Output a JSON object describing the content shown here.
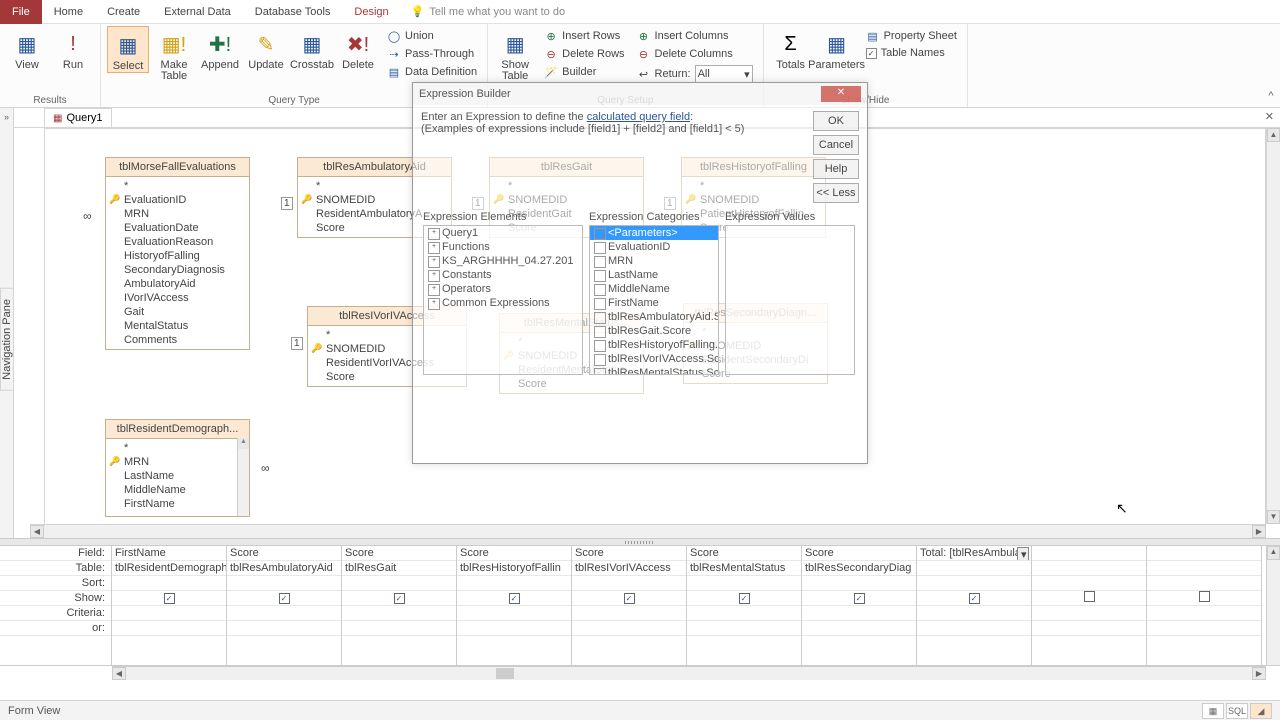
{
  "tabs": {
    "file": "File",
    "home": "Home",
    "create": "Create",
    "external": "External Data",
    "dbtools": "Database Tools",
    "design": "Design",
    "tellme": "Tell me what you want to do"
  },
  "ribbon": {
    "results": {
      "view": "View",
      "run": "Run",
      "label": "Results"
    },
    "qtype": {
      "select": "Select",
      "make": "Make\nTable",
      "append": "Append",
      "update": "Update",
      "crosstab": "Crosstab",
      "delete": "Delete",
      "union": "Union",
      "pass": "Pass-Through",
      "datadef": "Data Definition",
      "label": "Query Type"
    },
    "setup": {
      "show": "Show\nTable",
      "insrow": "Insert Rows",
      "delrow": "Delete Rows",
      "builder": "Builder",
      "inscol": "Insert Columns",
      "delcol": "Delete Columns",
      "return": "Return:",
      "retval": "All",
      "label": "Query Setup"
    },
    "showhide": {
      "totals": "Totals",
      "params": "Parameters",
      "prop": "Property Sheet",
      "tnames": "Table Names",
      "label": "Show/Hide"
    }
  },
  "qtab": "Query1",
  "tables": {
    "t1": {
      "name": "tblMorseFallEvaluations",
      "fields": [
        "*",
        "EvaluationID",
        "MRN",
        "EvaluationDate",
        "EvaluationReason",
        "HistoryofFalling",
        "SecondaryDiagnosis",
        "AmbulatoryAid",
        "IVorIVAccess",
        "Gait",
        "MentalStatus",
        "Comments"
      ],
      "keyIdx": 1
    },
    "t2": {
      "name": "tblResidentDemograph...",
      "fields": [
        "*",
        "MRN",
        "LastName",
        "MiddleName",
        "FirstName"
      ],
      "keyIdx": 1
    },
    "t3": {
      "name": "tblResAmbulatoryAid",
      "fields": [
        "*",
        "SNOMEDID",
        "ResidentAmbulatoryA",
        "Score"
      ],
      "keyIdx": 1
    },
    "t4": {
      "name": "tblResIVorIVAccess",
      "fields": [
        "*",
        "SNOMEDID",
        "ResidentIVorIVAccess",
        "Score"
      ],
      "keyIdx": 1
    },
    "t5": {
      "name": "tblResGait",
      "fields": [
        "*",
        "SNOMEDID",
        "ResidentGait",
        "Score"
      ],
      "keyIdx": 1
    },
    "t6": {
      "name": "tblResMentalStatus",
      "fields": [
        "*",
        "SNOMEDID",
        "ResidentMentalStatus",
        "Score"
      ],
      "keyIdx": 1
    },
    "t7": {
      "name": "tblResHistoryofFalling",
      "fields": [
        "*",
        "SNOMEDID",
        "PatientHistoryofFallin",
        "Score"
      ],
      "keyIdx": 1
    },
    "t8": {
      "name": "tblResSecondaryDiagn...",
      "fields": [
        "*",
        "SNOMEDID",
        "ResidentSecondaryDi",
        "Score"
      ],
      "keyIdx": 1
    }
  },
  "grid": {
    "labels": {
      "field": "Field:",
      "table": "Table:",
      "sort": "Sort:",
      "show": "Show:",
      "criteria": "Criteria:",
      "or": "or:"
    },
    "cols": [
      {
        "field": "FirstName",
        "table": "tblResidentDemograph",
        "show": true
      },
      {
        "field": "Score",
        "table": "tblResAmbulatoryAid",
        "show": true
      },
      {
        "field": "Score",
        "table": "tblResGait",
        "show": true
      },
      {
        "field": "Score",
        "table": "tblResHistoryofFallin",
        "show": true
      },
      {
        "field": "Score",
        "table": "tblResIVorIVAccess",
        "show": true
      },
      {
        "field": "Score",
        "table": "tblResMentalStatus",
        "show": true
      },
      {
        "field": "Score",
        "table": "tblResSecondaryDiag",
        "show": true
      },
      {
        "field": "Total: [tblResAmbulat",
        "table": "",
        "show": true,
        "dd": true
      },
      {
        "field": "",
        "table": "",
        "show": false
      },
      {
        "field": "",
        "table": "",
        "show": false
      }
    ]
  },
  "expr": {
    "title": "Expression Builder",
    "hint1": "Enter an Expression to define the ",
    "hintlink": "calculated query field",
    "hint1b": ":",
    "hint2": "(Examples of expressions include [field1] + [field2] and [field1] < 5)",
    "ok": "OK",
    "cancel": "Cancel",
    "help": "Help",
    "less": "<< Less",
    "elLbl": "Expression Elements",
    "catLbl": "Expression Categories",
    "valLbl": "Expression Values",
    "tree": [
      "Query1",
      "Functions",
      "KS_ARGHHHH_04.27.201",
      "Constants",
      "Operators",
      "Common Expressions"
    ],
    "cats": [
      "<Parameters>",
      "EvaluationID",
      "MRN",
      "LastName",
      "MiddleName",
      "FirstName",
      "tblResAmbulatoryAid.Sc",
      "tblResGait.Score",
      "tblResHistoryofFalling.S",
      "tblResIVorIVAccess.Sco",
      "tblResMentalStatus.Sco"
    ]
  },
  "status": {
    "view": "Form View",
    "sql": "SQL"
  },
  "navpane": "Navigation Pane"
}
